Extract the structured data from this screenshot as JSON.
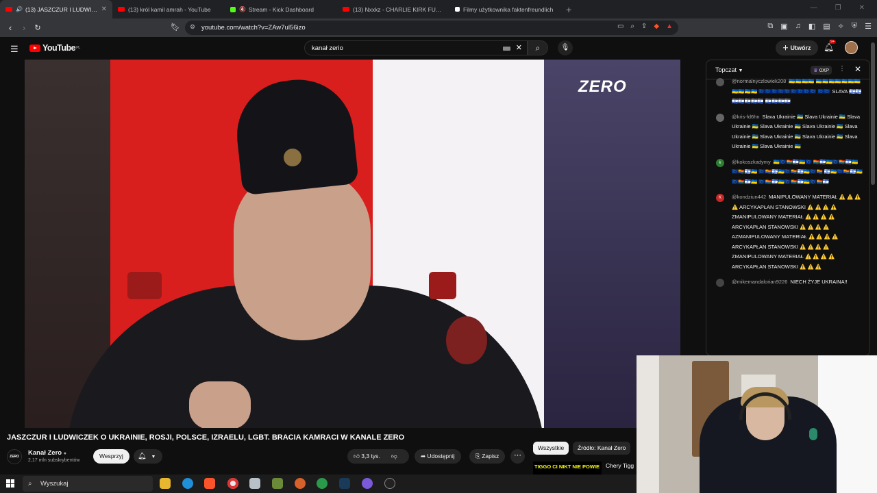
{
  "browser": {
    "tabs": [
      {
        "label": "(13) JASZCZUR I LUDWICZEK",
        "color": "#ff0000",
        "active": true,
        "audio": true
      },
      {
        "label": "(13) król kamil amrah - YouTube",
        "color": "#ff0000",
        "active": false,
        "audio": false
      },
      {
        "label": "Stream - Kick Dashboard",
        "color": "#53fc18",
        "active": false,
        "audio": true
      },
      {
        "label": "(13) Nxxkz - CHARLIE KIRK FUNK (Of",
        "color": "#ff0000",
        "active": false,
        "audio": false
      },
      {
        "label": "Filmy użytkownika faktenfreundlich",
        "color": "#ffffff",
        "active": false,
        "audio": false
      }
    ],
    "url": "youtube.com/watch?v=ZAw7ul56izo"
  },
  "youtube": {
    "logo": "YouTube",
    "region": "PL",
    "search_value": "kanał zerio",
    "create_label": "Utwórz",
    "notif_count": "9+"
  },
  "video": {
    "watermark": "ZERO",
    "title": "JASZCZUR I LUDWICZEK O UKRAINIE, ROSJI, POLSCE, IZRAELU, LGBT. BRACIA KAMRACI W KANALE ZERO",
    "channel": "Kanał Zero",
    "channel_avatar": "ZERO",
    "subs": "2,17 mln subskrybentów",
    "support_label": "Wesprzyj",
    "likes": "3,3 tys.",
    "share_label": "Udostępnij",
    "save_label": "Zapisz"
  },
  "related": {
    "chips": [
      "Wszystkie",
      "Źródło: Kanał Zero"
    ],
    "thumb_text": "TIGGO CI NIKT NIE POWIE",
    "thumb_title": "Chery Tigg"
  },
  "chat": {
    "title": "Topczat",
    "xp": "0XP",
    "messages": [
      {
        "user": "@normalnyczlowiek208",
        "text": "🇺🇦🇺🇦🇺🇦🇺🇦 🇺🇦🇺🇦🇺🇦🇺🇦🇺🇦🇺🇦🇺🇦🇺🇦🇺🇦🇺🇦🇺🇦 🇪🇺🇪🇺🇪🇺🇪🇺🇪🇺🇪🇺🇪🇺🇪🇺🇪🇺 🇪🇺🇪🇺 SLAVA 🇮🇱🇮🇱🇮🇱🇮🇱🇮🇱🇮🇱🇮🇱 🇮🇱🇮🇱🇮🇱🇮🇱",
        "avatar": "",
        "color": "#555555"
      },
      {
        "user": "@kris-fd6hn",
        "text": "Slava Ukrainie 🇺🇦 Slava Ukrainie 🇺🇦 Slava Ukrainie 🇺🇦 Slava Ukrainie 🇺🇦 Slava Ukrainie 🇺🇦 Slava Ukrainie 🇺🇦 Slava Ukrainie 🇺🇦 Slava Ukrainie 🇺🇦 Slava Ukrainie 🇺🇦 Slava Ukrainie 🇺🇦",
        "avatar": "",
        "color": "#666666"
      },
      {
        "user": "@kokoszkadymy",
        "text": "🇺🇦🇪🇺🏳️‍🌈🇮🇱🇺🇦🇪🇺 🏳️‍🌈🇮🇱🇺🇦🇪🇺🏳️‍🌈🇮🇱🇺🇦🇪🇺🏳️‍🌈🇮🇱🇺🇦 🇪🇺🏳️‍🌈🇮🇱🇺🇦🇪🇺🏳️‍🌈🇮🇱🇺🇦🇪🇺🏳️‍🌈 🇮🇱🇺🇦🇪🇺🏳️‍🌈🇮🇱🇺🇦🇪🇺🏳️‍🌈🇮🇱🇺🇦 🇪🇺🏳️‍🌈🇮🇱🇺🇦🇪🇺🏳️‍🌈🇮🇱🇺🇦🇪🇺🏳️‍🌈🇮🇱",
        "avatar": "k",
        "color": "#2e7d32"
      },
      {
        "user": "@kondziun442",
        "text": "MANIPULOWANY MATERIAŁ ⚠️ ⚠️ ⚠️ ⚠️ ARCYKAPŁAN STANOWSKI ⚠️ ⚠️ ⚠️ ⚠️ ZMANIPULOWANY MATERIAŁ ⚠️ ⚠️ ⚠️ ⚠️ ARCYKAPŁAN STANOWSKI ⚠️ ⚠️ ⚠️ ⚠️ AZMANIPULOWANY MATERIAŁ ⚠️ ⚠️ ⚠️ ⚠️ ARCYKAPŁAN STANOWSKI ⚠️ ⚠️ ⚠️ ⚠️ ZMANIPULOWANY MATERIAŁ ⚠️ ⚠️ ⚠️ ⚠️ ARCYKAPŁAN STANOWSKI ⚠️ ⚠️ ⚠️",
        "avatar": "K",
        "color": "#c62828"
      },
      {
        "user": "@mikemandalorian9226",
        "text": "NIECH ŻYJE UKRAINA!!",
        "avatar": "",
        "color": "#444444"
      }
    ]
  },
  "taskbar": {
    "search_label": "Wyszukaj"
  }
}
